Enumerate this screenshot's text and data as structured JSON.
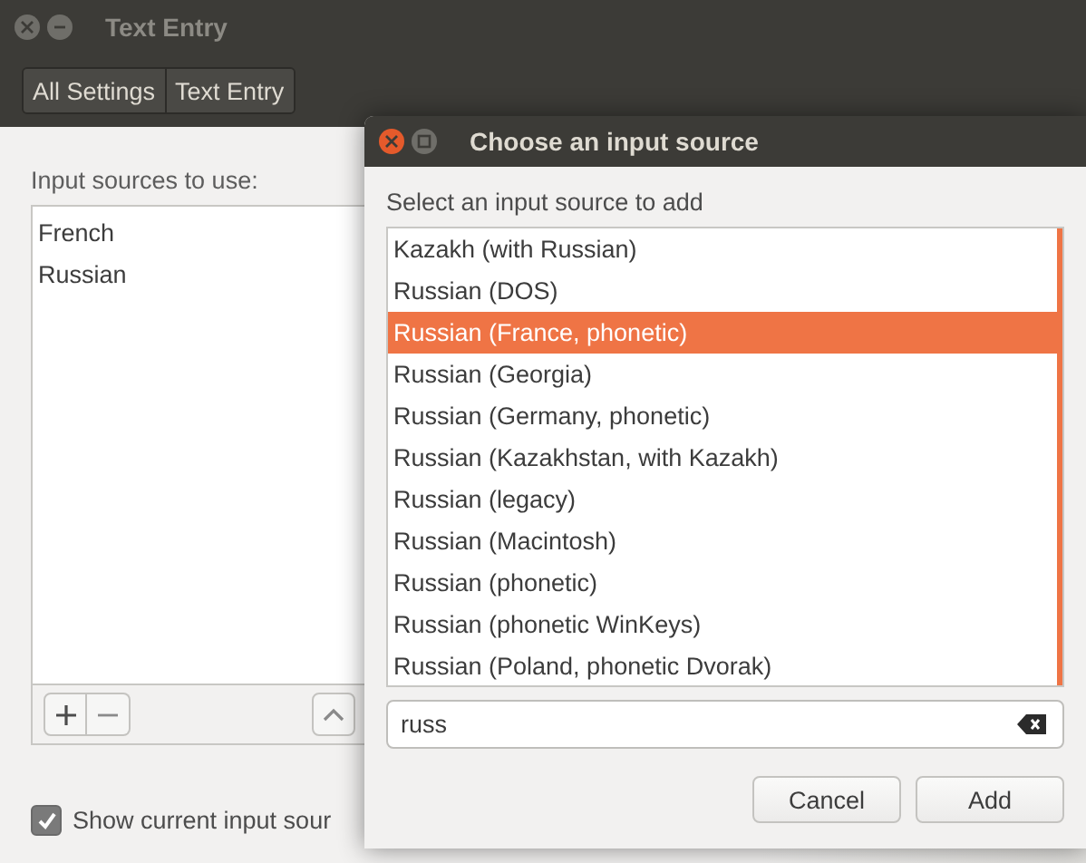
{
  "window": {
    "title": "Text Entry"
  },
  "breadcrumbs": [
    "All Settings",
    "Text Entry"
  ],
  "input_sources": {
    "label": "Input sources to use:",
    "items": [
      "French",
      "Russian"
    ]
  },
  "show_current": {
    "label": "Show current input sour",
    "checked": true
  },
  "dialog": {
    "title": "Choose an input source",
    "prompt": "Select an input source to add",
    "items": [
      {
        "label": "Kazakh (with Russian)",
        "selected": false
      },
      {
        "label": "Russian (DOS)",
        "selected": false
      },
      {
        "label": "Russian (France, phonetic)",
        "selected": true
      },
      {
        "label": "Russian (Georgia)",
        "selected": false
      },
      {
        "label": "Russian (Germany, phonetic)",
        "selected": false
      },
      {
        "label": "Russian (Kazakhstan, with Kazakh)",
        "selected": false
      },
      {
        "label": "Russian (legacy)",
        "selected": false
      },
      {
        "label": "Russian (Macintosh)",
        "selected": false
      },
      {
        "label": "Russian (phonetic)",
        "selected": false
      },
      {
        "label": "Russian (phonetic WinKeys)",
        "selected": false
      },
      {
        "label": "Russian (Poland, phonetic Dvorak)",
        "selected": false
      }
    ],
    "search": {
      "value": "russ"
    },
    "buttons": [
      "Cancel",
      "Add"
    ]
  }
}
